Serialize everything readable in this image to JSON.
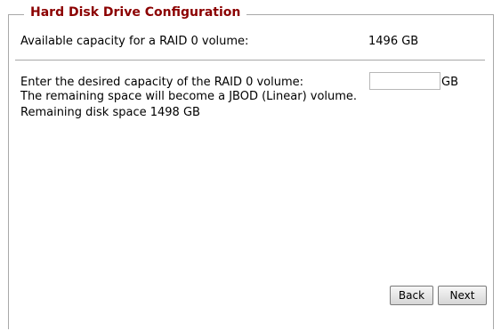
{
  "section": {
    "title": "Hard Disk Drive Configuration"
  },
  "capacity": {
    "label": "Available capacity for a RAID 0 volume:",
    "value": "1496 GB"
  },
  "raid_input": {
    "label": "Enter the desired capacity of the RAID 0 volume:",
    "value": "",
    "placeholder": "",
    "unit": "GB"
  },
  "info": {
    "remaining_note": "The remaining space will become a JBOD (Linear) volume.",
    "remaining_space": "Remaining disk space 1498 GB"
  },
  "buttons": {
    "back": "Back",
    "next": "Next"
  },
  "colors": {
    "title": "#8b0000",
    "border": "#a8a8a8"
  }
}
